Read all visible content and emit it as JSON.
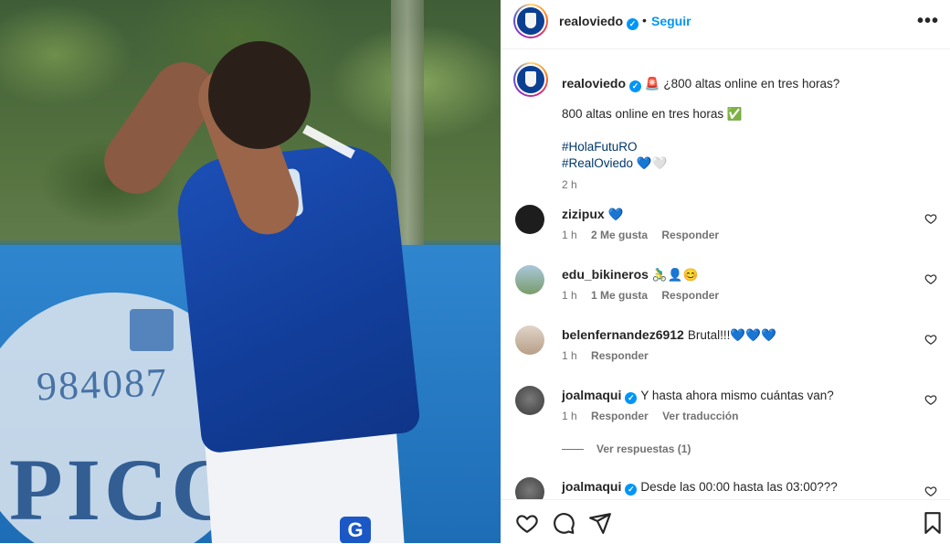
{
  "media": {
    "phone_text": "984087",
    "sign_text": "PICCO",
    "jersey_logo": "G"
  },
  "header": {
    "username": "realoviedo",
    "dot": "•",
    "follow_label": "Seguir",
    "more_label": "•••"
  },
  "caption": {
    "username": "realoviedo",
    "text": "🚨 ¿800 altas online en tres horas?",
    "line2": "800 altas online en tres horas ✅",
    "hashtags": [
      "#HolaFutuRO",
      "#RealOviedo"
    ],
    "hashtag_suffix": "💙🤍",
    "time": "2 h"
  },
  "comments": [
    {
      "username": "zizipux",
      "text": "💙",
      "time": "1 h",
      "likes": "2 Me gusta",
      "reply": "Responder",
      "verified": false,
      "avatar_color": "#1d1d1d"
    },
    {
      "username": "edu_bikineros",
      "text": "🚴‍♂️👤😊",
      "time": "1 h",
      "likes": "1 Me gusta",
      "reply": "Responder",
      "verified": false,
      "avatar_color": "#8fb3c9"
    },
    {
      "username": "belenfernandez6912",
      "text": "Brutal!!!💙💙💙",
      "time": "1 h",
      "likes": "",
      "reply": "Responder",
      "verified": false,
      "avatar_color": "#c9b8a8"
    },
    {
      "username": "joalmaqui",
      "text": "Y hasta ahora mismo cuántas van?",
      "time": "1 h",
      "likes": "",
      "reply": "Responder",
      "extra": "Ver traducción",
      "verified": true,
      "avatar_color": "#5a5a5a"
    },
    {
      "username": "joalmaqui",
      "text": "Desde las 00:00 hasta las 03:00???",
      "verified": true,
      "avatar_color": "#5a5a5a"
    }
  ],
  "view_replies": "Ver respuestas (1)",
  "colors": {
    "accent": "#0095f6",
    "hashtag": "#00376b",
    "muted": "#737373"
  }
}
